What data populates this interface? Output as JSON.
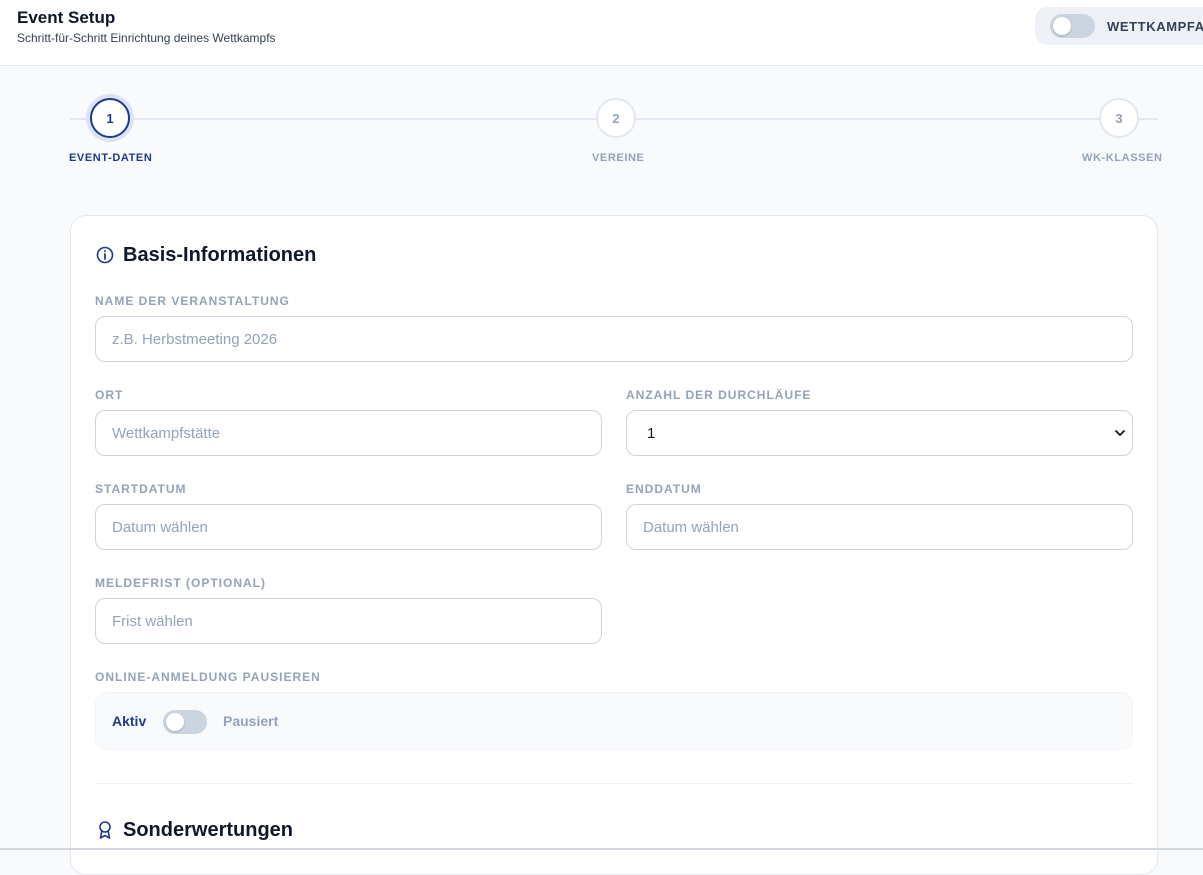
{
  "header": {
    "title": "Event Setup",
    "subtitle": "Schritt-für-Schritt Einrichtung deines Wettkampfs",
    "mode_label": "WETTKAMPFANSICHT"
  },
  "stepper": {
    "steps": [
      {
        "number": "1",
        "label": "EVENT-DATEN",
        "active": true
      },
      {
        "number": "2",
        "label": "VEREINE",
        "active": false
      },
      {
        "number": "3",
        "label": "WK-KLASSEN",
        "active": false
      }
    ]
  },
  "basis": {
    "title": "Basis-Informationen",
    "name_label": "NAME DER VERANSTALTUNG",
    "name_placeholder": "z.B. Herbstmeeting 2026",
    "ort_label": "ORT",
    "ort_placeholder": "Wettkampfstätte",
    "durchlaeufe_label": "ANZAHL DER DURCHLÄUFE",
    "durchlaeufe_value": "1",
    "startdatum_label": "STARTDATUM",
    "startdatum_placeholder": "Datum wählen",
    "enddatum_label": "ENDDATUM",
    "enddatum_placeholder": "Datum wählen",
    "meldefrist_label": "MELDEFRIST (OPTIONAL)",
    "meldefrist_placeholder": "Frist wählen",
    "pause_label": "ONLINE-ANMELDUNG PAUSIEREN",
    "pause_active_text": "Aktiv",
    "pause_paused_text": "Pausiert"
  },
  "sonder": {
    "title": "Sonderwertungen"
  },
  "colors": {
    "accent": "#1e3a8a",
    "muted": "#94a3b8",
    "border": "#cbd5e1"
  }
}
